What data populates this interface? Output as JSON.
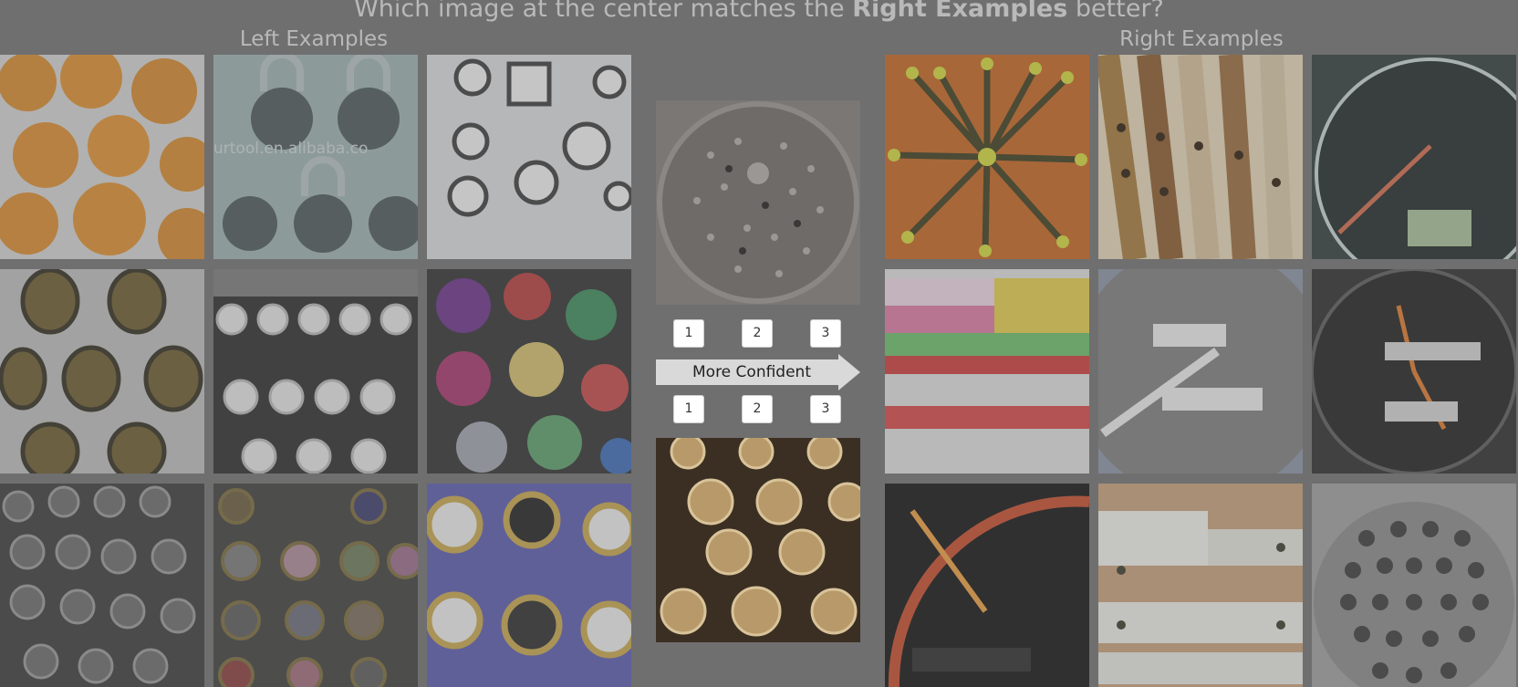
{
  "header": {
    "question_prefix": "Which image at the center matches the ",
    "question_bold": "Right Examples",
    "question_suffix": " better?"
  },
  "left_label": "Left Examples",
  "right_label": "Right Examples",
  "left_examples": [
    "oranges",
    "combination-padlocks",
    "wall-clocks",
    "ornate-medallions",
    "typewriter-keys",
    "bottle-caps",
    "typewriter-keys-dark",
    "bottle-cap-pins",
    "brass-clocks"
  ],
  "right_examples": [
    "pencils-bundle",
    "wooden-flutes",
    "speedometer",
    "color-cubes",
    "odometer-gauge",
    "speedometer-yellow",
    "speedometer-red-needle",
    "white-drawers",
    "speaker-grille"
  ],
  "query": {
    "top_image": "manhole-cover",
    "bottom_image": "typewriter-keys-brown"
  },
  "confidence": {
    "label": "More Confident",
    "top_options": [
      "1",
      "2",
      "3"
    ],
    "bottom_options": [
      "1",
      "2",
      "3"
    ]
  },
  "watermark": "urtool.en.alibaba.co"
}
